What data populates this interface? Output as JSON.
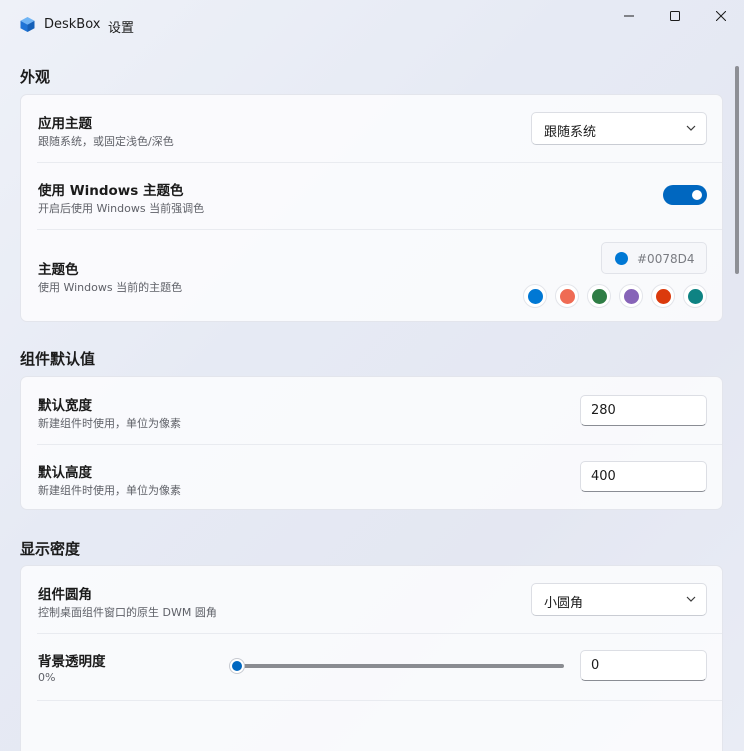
{
  "app": {
    "name": "DeskBox",
    "subtitle": "设置"
  },
  "colors": {
    "accent": "#0067c0",
    "logo": "#1f74d6"
  },
  "sections": {
    "appearance": {
      "title": "外观",
      "theme": {
        "title": "应用主题",
        "desc": "跟随系统，或固定浅色/深色",
        "value": "跟随系统"
      },
      "windows_accent": {
        "title": "使用 Windows 主题色",
        "desc": "开启后使用 Windows 当前强调色",
        "enabled": true
      },
      "theme_color": {
        "title": "主题色",
        "desc": "使用 Windows 当前的主题色",
        "hex": "#0078D4",
        "swatches": [
          "#0078d4",
          "#ef6b54",
          "#2f7d45",
          "#8764b8",
          "#db3a0d",
          "#0e8383"
        ]
      }
    },
    "defaults": {
      "title": "组件默认值",
      "width": {
        "title": "默认宽度",
        "desc": "新建组件时使用，单位为像素",
        "value": "280"
      },
      "height": {
        "title": "默认高度",
        "desc": "新建组件时使用，单位为像素",
        "value": "400"
      }
    },
    "density": {
      "title": "显示密度",
      "corner": {
        "title": "组件圆角",
        "desc": "控制桌面组件窗口的原生 DWM 圆角",
        "value": "小圆角"
      },
      "opacity": {
        "title": "背景透明度",
        "desc": "0%",
        "value": "0",
        "level": 0
      }
    }
  }
}
